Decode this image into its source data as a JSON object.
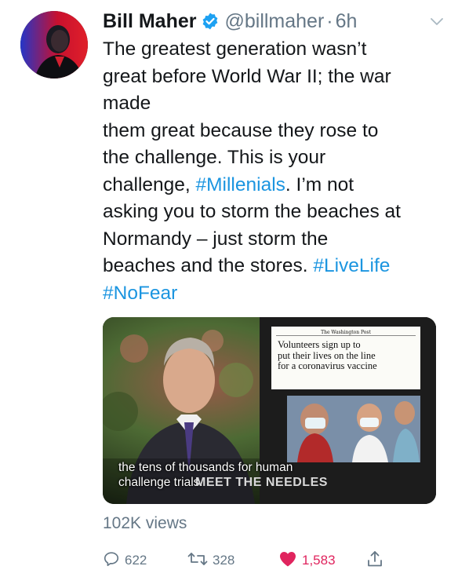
{
  "tweet": {
    "display_name": "Bill Maher",
    "handle": "@billmaher",
    "separator": "·",
    "time": "6h",
    "text_lines": [
      [
        {
          "t": "The greatest generation wasn’t"
        }
      ],
      [
        {
          "t": "great before World War II; the war"
        }
      ],
      [
        {
          "t": "made"
        }
      ],
      [
        {
          "t": "them great because they rose to"
        }
      ],
      [
        {
          "t": "the challenge. This is your"
        }
      ],
      [
        {
          "t": "challenge, "
        },
        {
          "t": "#Millenials",
          "tag": true
        },
        {
          "t": ". I’m not"
        }
      ],
      [
        {
          "t": "asking you to storm the beaches at"
        }
      ],
      [
        {
          "t": "Normandy – just storm the"
        }
      ],
      [
        {
          "t": "beaches and the stores. "
        },
        {
          "t": "#LiveLife",
          "tag": true
        }
      ],
      [
        {
          "t": "#NoFear",
          "tag": true
        }
      ]
    ]
  },
  "media": {
    "caption_line1": "the tens of thousands for human",
    "caption_line2": "challenge trials.",
    "overlay_title": "MEET THE NEEDLES",
    "wp_masthead": "The Washington Post",
    "wp_headline_1": "Volunteers sign up to",
    "wp_headline_2": "put their lives on the line",
    "wp_headline_3": "for a coronavirus vaccine"
  },
  "stats": {
    "views": "102K views",
    "replies": "622",
    "retweets": "328",
    "likes": "1,583"
  },
  "colors": {
    "link": "#1b95e0",
    "verified": "#1da1f2",
    "secondary": "#657786",
    "like": "#e0245e"
  },
  "icons": {
    "verified": "verified-badge-icon",
    "caret": "chevron-down-icon",
    "reply": "reply-icon",
    "retweet": "retweet-icon",
    "like": "heart-icon",
    "share": "share-icon"
  }
}
